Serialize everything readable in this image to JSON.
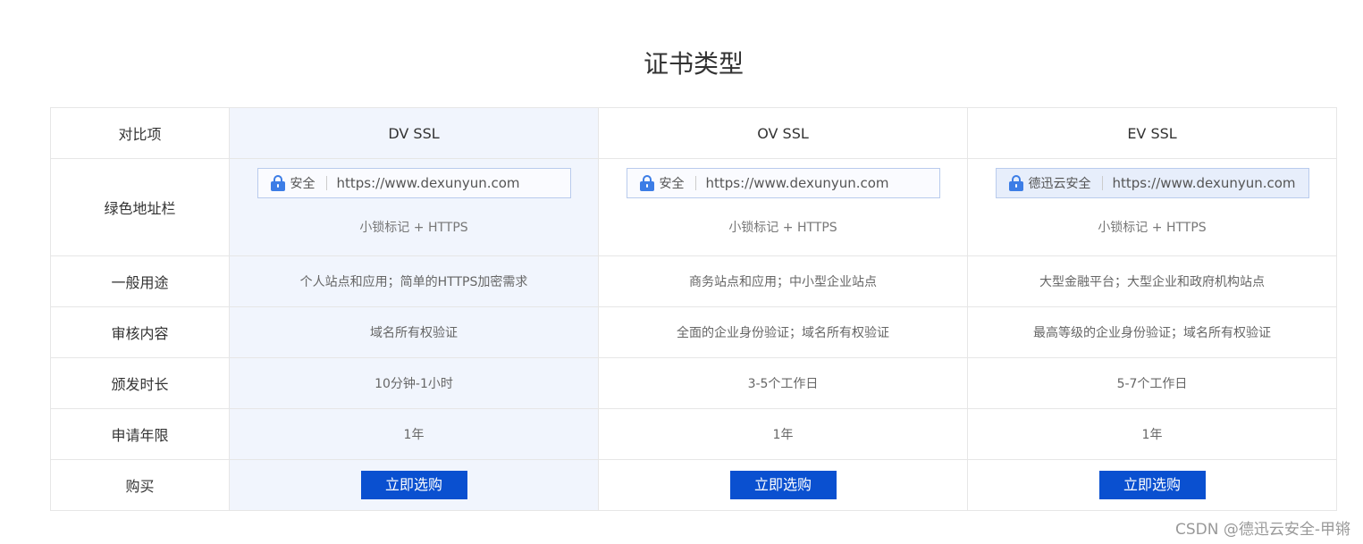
{
  "title": "证书类型",
  "table": {
    "header_label": "对比项",
    "plans": [
      {
        "name": "DV SSL",
        "addr_secure_text": "安全",
        "addr_url": "https://www.dexunyun.com",
        "addr_caption": "小锁标记 + HTTPS",
        "usage": "个人站点和应用；简单的HTTPS加密需求",
        "validation": "域名所有权验证",
        "issue_time": "10分钟-1小时",
        "term": "1年",
        "buy_label": "立即选购"
      },
      {
        "name": "OV SSL",
        "addr_secure_text": "安全",
        "addr_url": "https://www.dexunyun.com",
        "addr_caption": "小锁标记 + HTTPS",
        "usage": "商务站点和应用；中小型企业站点",
        "validation": "全面的企业身份验证；域名所有权验证",
        "issue_time": "3-5个工作日",
        "term": "1年",
        "buy_label": "立即选购"
      },
      {
        "name": "EV SSL",
        "addr_secure_text": "德迅云安全",
        "addr_url": "https://www.dexunyun.com",
        "addr_caption": "小锁标记 + HTTPS",
        "usage": "大型金融平台；大型企业和政府机构站点",
        "validation": "最高等级的企业身份验证；域名所有权验证",
        "issue_time": "5-7个工作日",
        "term": "1年",
        "buy_label": "立即选购"
      }
    ],
    "row_labels": {
      "address_bar": "绿色地址栏",
      "usage": "一般用途",
      "validation": "审核内容",
      "issue_time": "颁发时长",
      "term": "申请年限",
      "buy": "购买"
    }
  },
  "watermark": "CSDN @德迅云安全-甲锵",
  "colors": {
    "button_bg": "#0a50d0",
    "highlight_column_bg": "#f1f5fd",
    "lock_icon": "#3c7de6"
  },
  "icons": [
    "lock-icon"
  ]
}
